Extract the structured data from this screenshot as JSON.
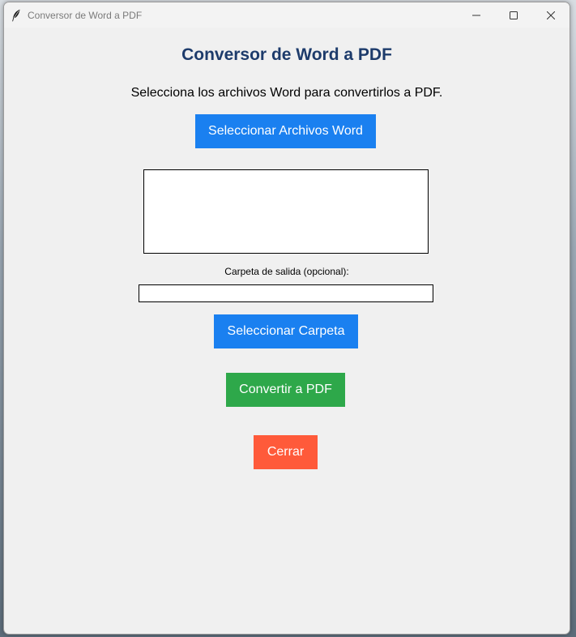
{
  "window": {
    "title": "Conversor de Word a PDF"
  },
  "header": {
    "title": "Conversor de Word a PDF",
    "instruction": "Selecciona los archivos Word para convertirlos a PDF."
  },
  "buttons": {
    "select_files": "Seleccionar Archivos Word",
    "select_folder": "Seleccionar Carpeta",
    "convert": "Convertir a PDF",
    "close": "Cerrar"
  },
  "files_list": {
    "items": []
  },
  "output": {
    "label": "Carpeta de salida (opcional):",
    "value": ""
  },
  "colors": {
    "heading": "#1d3b6b",
    "select_button": "#1a80f0",
    "convert_button": "#2ea84a",
    "close_button": "#ff5a3a",
    "window_background": "#f0f0f0"
  },
  "icons": {
    "app": "feather-icon",
    "minimize": "minimize-icon",
    "maximize": "maximize-icon",
    "close": "close-icon"
  }
}
